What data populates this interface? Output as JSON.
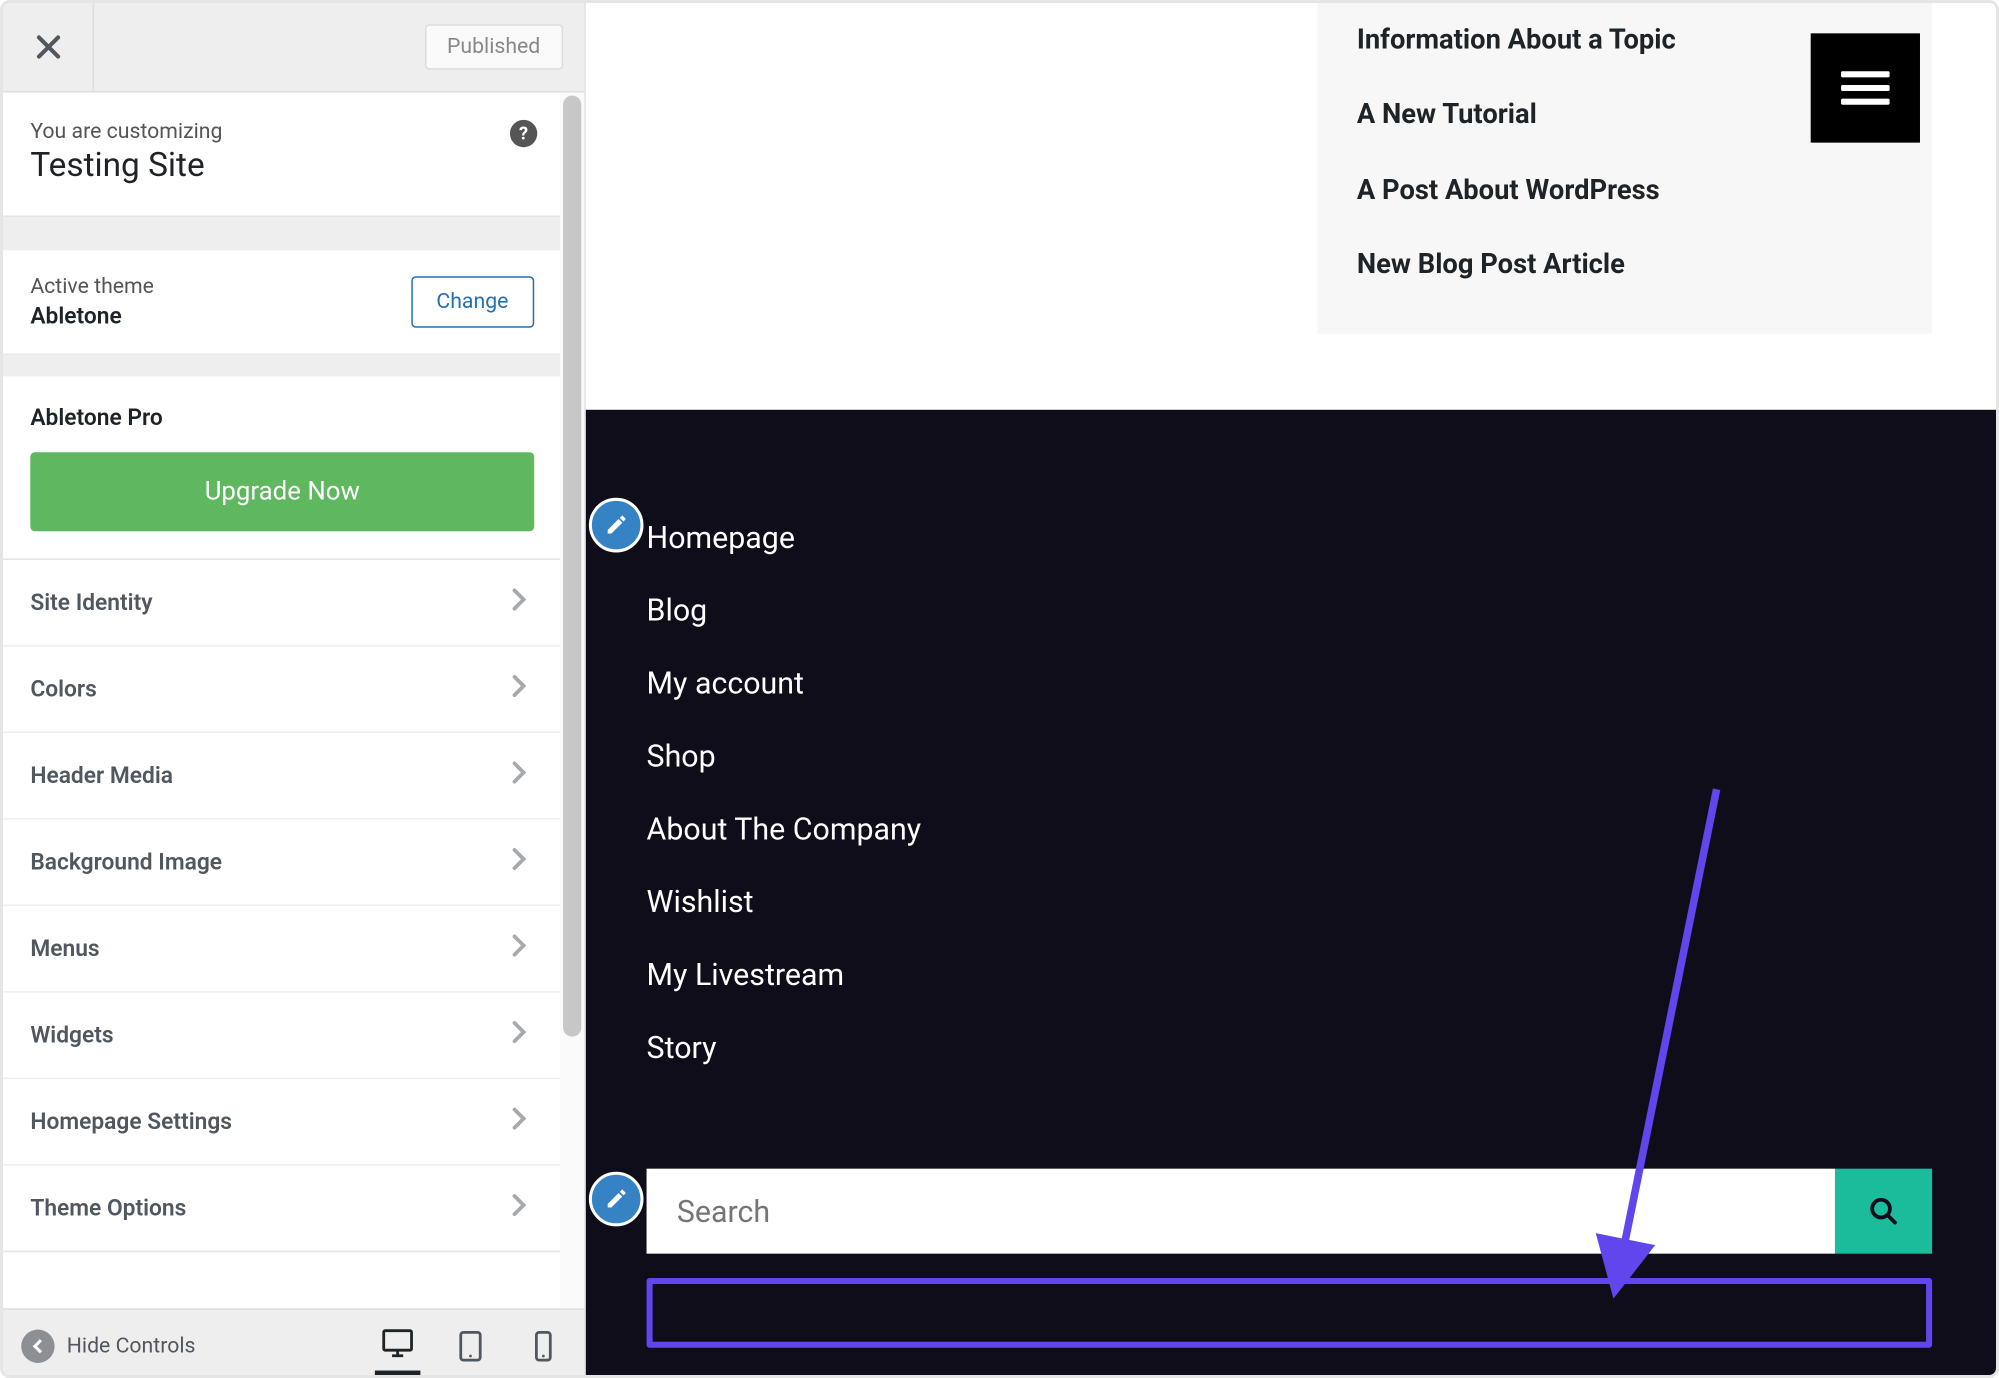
{
  "header": {
    "publish_status": "Published",
    "customizing_label": "You are customizing",
    "site_title": "Testing Site"
  },
  "theme": {
    "label": "Active theme",
    "name": "Abletone",
    "change_label": "Change"
  },
  "pro": {
    "title": "Abletone Pro",
    "upgrade_label": "Upgrade Now"
  },
  "sidebar_nav": [
    "Site Identity",
    "Colors",
    "Header Media",
    "Background Image",
    "Menus",
    "Widgets",
    "Homepage Settings",
    "Theme Options"
  ],
  "bottom": {
    "hide_controls_label": "Hide Controls"
  },
  "preview": {
    "posts": [
      "Information About a Topic",
      "A New Tutorial",
      "A Post About WordPress",
      "New Blog Post Article"
    ],
    "footer_menu": [
      "Homepage",
      "Blog",
      "My account",
      "Shop",
      "About The Company",
      "Wishlist",
      "My Livestream",
      "Story"
    ],
    "search_placeholder": "Search"
  }
}
